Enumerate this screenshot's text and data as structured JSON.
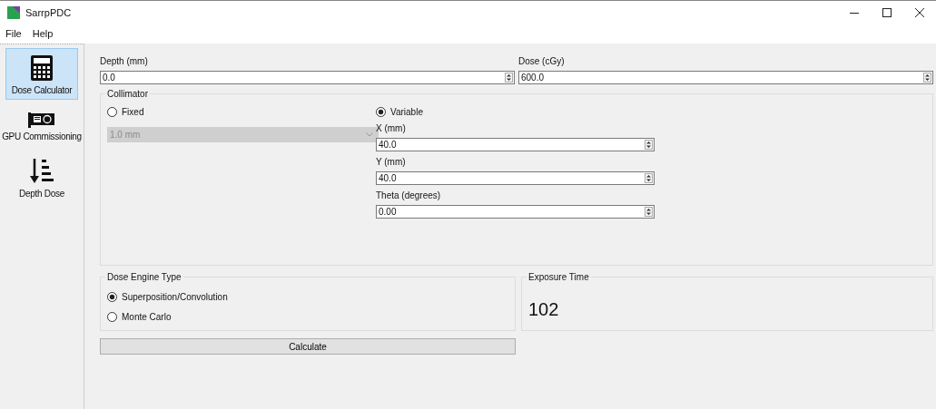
{
  "window": {
    "title": "SarrpPDC"
  },
  "menu": [
    "File",
    "Help"
  ],
  "sidebar": {
    "items": [
      {
        "label": "Dose Calculator",
        "kind": "calculator",
        "selected": true
      },
      {
        "label": "GPU Commissioning",
        "kind": "gpu",
        "selected": false
      },
      {
        "label": "Depth Dose",
        "kind": "depth",
        "selected": false
      }
    ]
  },
  "top_fields": [
    {
      "label": "Depth (mm)",
      "value": "0.0"
    },
    {
      "label": "Dose (cGy)",
      "value": "600.0"
    }
  ],
  "collimator": {
    "title": "Collimator",
    "fixed": {
      "label": "Fixed",
      "selected": false,
      "combo_value": "1.0 mm",
      "disabled": true
    },
    "variable": {
      "label": "Variable",
      "selected": true,
      "fields": [
        {
          "label": "X (mm)",
          "value": "40.0"
        },
        {
          "label": "Y (mm)",
          "value": "40.0"
        },
        {
          "label": "Theta (degrees)",
          "value": "0.00"
        }
      ]
    }
  },
  "dose_engine": {
    "title": "Dose Engine Type",
    "options": [
      {
        "label": "Superposition/Convolution",
        "selected": true
      },
      {
        "label": "Monte Carlo",
        "selected": false
      }
    ]
  },
  "exposure": {
    "title": "Exposure Time",
    "value": "102"
  },
  "calculate_button": "Calculate"
}
